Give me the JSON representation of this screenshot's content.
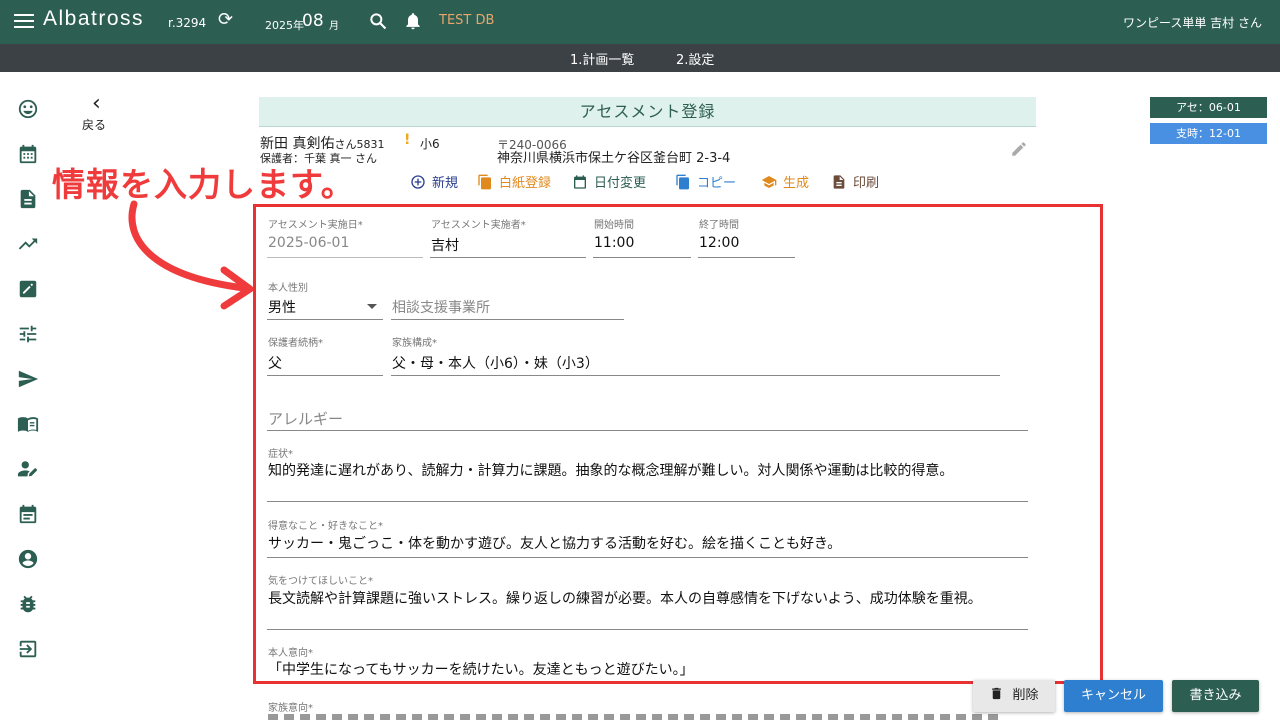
{
  "header": {
    "app_name": "Albatross",
    "revision": "r.3294",
    "year": "2025年",
    "month": "08",
    "month_label": "月",
    "db_label": "TEST DB",
    "user": "ワンピース単単 吉村 さん"
  },
  "subnav": {
    "tabs": [
      "1.計画一覧",
      "2.設定"
    ]
  },
  "sidebar": {
    "icons": [
      "smiley-icon",
      "calendar-icon",
      "document-icon",
      "trending-up-icon",
      "edit-icon",
      "tune-icon",
      "send-icon",
      "book-icon",
      "user-edit-icon",
      "event-icon",
      "account-circle-icon",
      "bug-icon",
      "login-icon"
    ]
  },
  "back": {
    "label": "戻る"
  },
  "title": "アセスメント登録",
  "badges": [
    {
      "text": "アセ：06-01",
      "color": "#2c5e52"
    },
    {
      "text": "支時：12-01",
      "color": "#4a90e2"
    }
  ],
  "person": {
    "name": "新田 真剣佑",
    "san": "さん",
    "id": "5831",
    "alert": "!",
    "grade": "小6",
    "guardian": "保護者：千葉 真一 さん",
    "zip": "〒240-0066",
    "address": "神奈川県横浜市保土ケ谷区釜台町 2-3-4"
  },
  "actions": [
    {
      "label": "新規",
      "color": "#2a3d8f"
    },
    {
      "label": "白紙登録",
      "color": "#e08a1e"
    },
    {
      "label": "日付変更",
      "color": "#2c5e52"
    },
    {
      "label": "コピー",
      "color": "#2f7fd0"
    },
    {
      "label": "生成",
      "color": "#e08a1e"
    },
    {
      "label": "印刷",
      "color": "#6b4b3a"
    }
  ],
  "annotation": "情報を入力します。",
  "form": {
    "date_label": "アセスメント実施日*",
    "date_value": "2025-06-01",
    "assessor_label": "アセスメント実施者*",
    "assessor_value": "吉村",
    "start_label": "開始時間",
    "start_value": "11:00",
    "end_label": "終了時間",
    "end_value": "12:00",
    "gender_label": "本人性別",
    "gender_value": "男性",
    "office_placeholder": "相談支援事業所",
    "relation_label": "保護者続柄*",
    "relation_value": "父",
    "family_label": "家族構成*",
    "family_value": "父・母・本人（小6）・妹（小3）",
    "allergy_placeholder": "アレルギー",
    "symptom_label": "症状*",
    "symptom_value": "知的発達に遅れがあり、読解力・計算力に課題。抽象的な概念理解が難しい。対人関係や運動は比較的得意。",
    "good_label": "得意なこと・好きなこと*",
    "good_value": "サッカー・鬼ごっこ・体を動かす遊び。友人と協力する活動を好む。絵を描くことも好き。",
    "care_label": "気をつけてほしいこと*",
    "care_value": "長文読解や計算課題に強いストレス。繰り返しの練習が必要。本人の自尊感情を下げないよう、成功体験を重視。",
    "intent_label": "本人意向*",
    "intent_value": "「中学生になってもサッカーを続けたい。友達ともっと遊びたい。」",
    "family_intent_label": "家族意向*"
  },
  "buttons": {
    "delete": "削除",
    "cancel": "キャンセル",
    "save": "書き込み"
  }
}
